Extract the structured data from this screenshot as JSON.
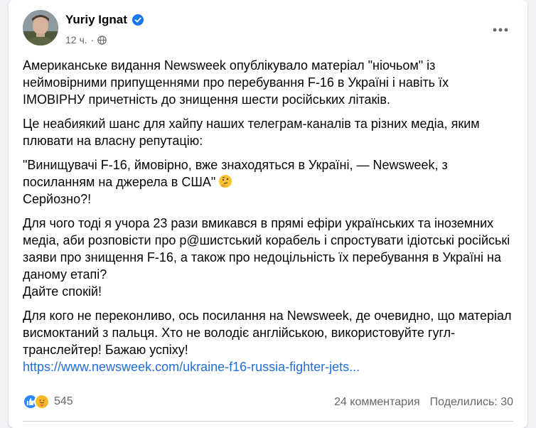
{
  "post": {
    "author": "Yuriy Ignat",
    "time": "12 ч.",
    "dot": "·",
    "paragraphs": [
      "Американське видання Newsweek опублікувало матеріал \"ніочьом\" із неймовірними припущеннями про перебування F-16 в Україні і навіть їх ІМОВІРНУ причетність до знищення шести російських літаків.",
      "Це неабиякий шанс для хайпу наших телеграм-каналів та різних медіа, яким плювати на власну репутацію:",
      "\"Винищувачі F-16, ймовірно, вже знаходяться в Україні, — Newsweek, з посиланням на джерела в США\"",
      "Серйозно?!",
      "Для чого тоді я учора 23 рази вмикався в прямі ефіри українських та іноземних медіа, аби розповісти про р@шистський корабель і спростувати ідіотські російські заяви про знищення F-16, а також про недоцільність їх перебування в Україні на даному етапі?",
      "Дайте спокій!",
      "Для кого не переконливо, ось посилання на Newsweek, де очевидно, що матеріал висмоктаний з пальця. Хто не володіє англійською, використовуйте гугл-транслейтер! Бажаю успіху!"
    ],
    "link": "https://www.newsweek.com/ukraine-f16-russia-fighter-jets..."
  },
  "footer": {
    "reactions_count": "545",
    "comments": "24 комментария",
    "shares": "Поделились: 30"
  },
  "icons": {
    "verified": "verified-badge-icon",
    "globe": "globe-icon",
    "more": "more-options-icon",
    "thinking": "thinking-face-emoji",
    "like": "like-reaction-icon",
    "care": "care-reaction-icon"
  },
  "colors": {
    "accent": "#216fdb",
    "like": "#2d88ff",
    "care": "#f7b928",
    "secondary_text": "#65676b"
  }
}
